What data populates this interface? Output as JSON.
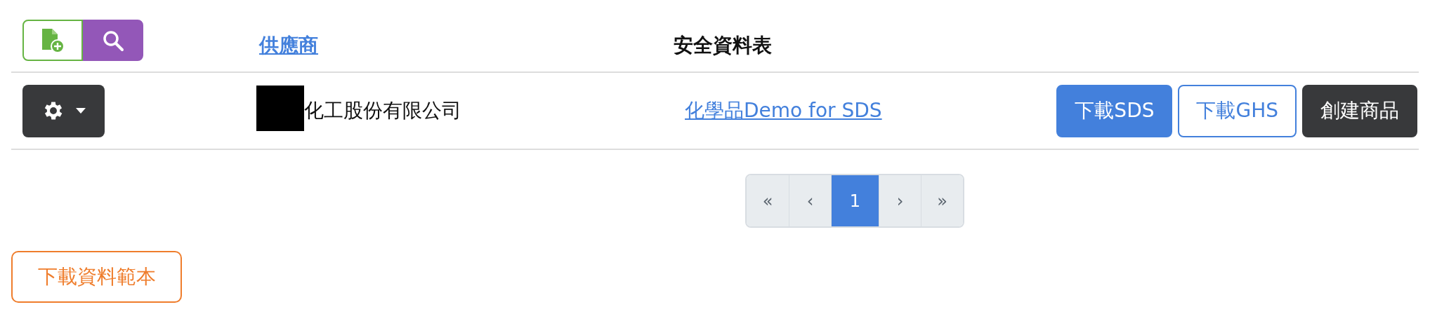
{
  "toolbar": {
    "buttons": [
      {
        "kind": "add-file"
      },
      {
        "kind": "search"
      }
    ]
  },
  "table": {
    "columns": [
      {
        "label": "供應商",
        "kind": "link"
      },
      {
        "label": "安全資料表",
        "kind": "plain"
      }
    ],
    "rows": [
      {
        "redacted": true,
        "supplier": "化工股份有限公司",
        "sds": "化學品Demo for SDS",
        "actions": [
          {
            "label": "下載SDS",
            "kind": "primary"
          },
          {
            "label": "下載GHS",
            "kind": "outline"
          },
          {
            "label": "創建商品",
            "kind": "dark"
          }
        ]
      }
    ]
  },
  "pagination": [
    {
      "label": "«",
      "selected": false
    },
    {
      "label": "‹",
      "selected": false
    },
    {
      "label": "1",
      "selected": true
    },
    {
      "label": "›",
      "selected": false
    },
    {
      "label": "»",
      "selected": false
    }
  ],
  "download_template": "下載資料範本"
}
